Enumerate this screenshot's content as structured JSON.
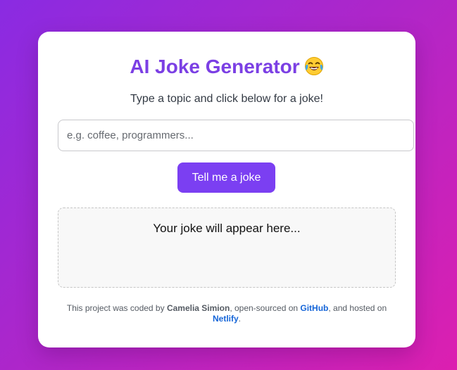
{
  "header": {
    "title": "AI Joke Generator",
    "emoji": "laughing-tears-emoji"
  },
  "subtitle": "Type a topic and click below for a joke!",
  "topic_input": {
    "value": "",
    "placeholder": "e.g. coffee, programmers..."
  },
  "joke_button": {
    "label": "Tell me a joke"
  },
  "joke_output": {
    "text": "Your joke will appear here..."
  },
  "footer": {
    "prefix": "This project was coded by ",
    "author": "Camelia Simion",
    "middle": ", open-sourced on ",
    "github_link": "GitHub",
    "middle2": ", and hosted on ",
    "netlify_link": "Netlify",
    "suffix": "."
  },
  "colors": {
    "accent": "#7b3ff2",
    "title": "#7b3fe4",
    "link": "#1565d8",
    "background_start": "#8a2be2",
    "background_end": "#dc1fb0"
  }
}
